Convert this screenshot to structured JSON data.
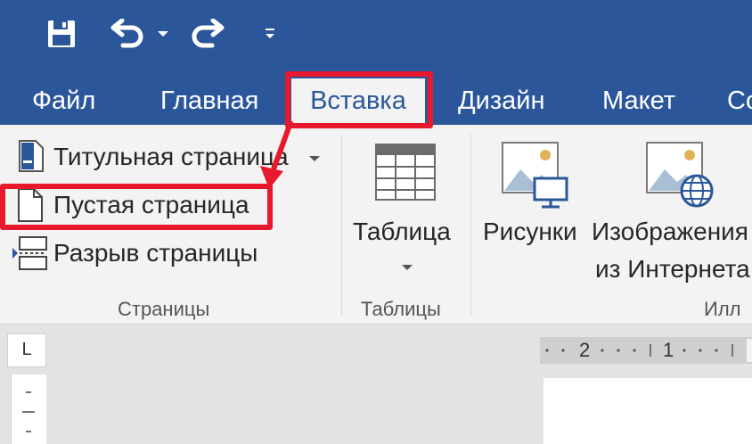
{
  "qat": {
    "save_icon": "save-icon",
    "undo_icon": "undo-icon",
    "undo_dropdown_icon": "chevron-down-icon",
    "redo_icon": "redo-icon",
    "customize_icon": "customize-qat-icon"
  },
  "tabs": {
    "file": "Файл",
    "home": "Главная",
    "insert": "Вставка",
    "design": "Дизайн",
    "layout": "Макет",
    "references_partial": "Со"
  },
  "ribbon": {
    "pages_group": {
      "cover_page": "Титульная страница",
      "blank_page": "Пустая страница",
      "page_break": "Разрыв страницы",
      "label": "Страницы"
    },
    "tables_group": {
      "table": "Таблица",
      "label": "Таблицы"
    },
    "illustrations_group": {
      "pictures": "Рисунки",
      "online_pictures_line1": "Изображения",
      "online_pictures_line2": "из Интернета",
      "label_partial": "Илл"
    }
  },
  "ruler": {
    "tab_selector": "L",
    "marks": [
      "2",
      "1"
    ]
  },
  "colors": {
    "ribbon_blue": "#2b579a",
    "highlight_red": "#e8192c"
  }
}
